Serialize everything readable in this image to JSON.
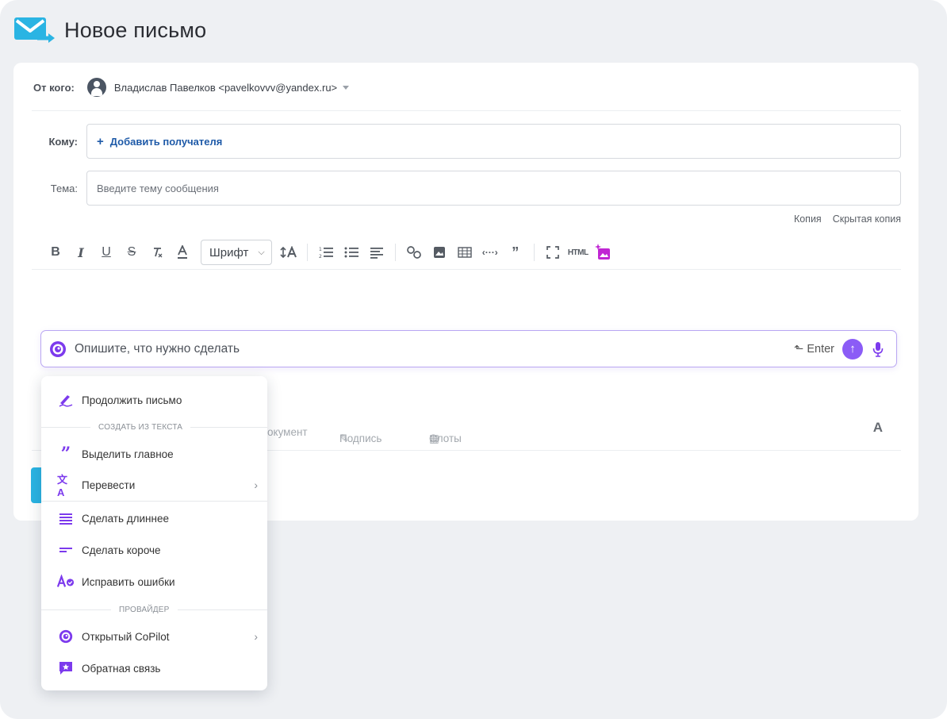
{
  "header": {
    "title": "Новое письмо"
  },
  "from": {
    "label": "От кого:",
    "value": "Владислав Павелков <pavelkovvv@yandex.ru>"
  },
  "to": {
    "label": "Кому:",
    "add_label": "Добавить получателя"
  },
  "subject": {
    "label": "Тема:",
    "placeholder": "Введите тему сообщения"
  },
  "cc": {
    "copy": "Копия",
    "bcc": "Скрытая копия"
  },
  "toolbar": {
    "bold": "B",
    "italic": "I",
    "underline": "U",
    "strike": "S",
    "font_label": "Шрифт",
    "html": "HTML"
  },
  "ai": {
    "placeholder": "Опишите, что нужно сделать",
    "enter_hint": "Enter"
  },
  "bottom": {
    "document": "окумент",
    "signature": "Подпись",
    "slots": "Слоты",
    "font_a": "A"
  },
  "menu": {
    "continue": "Продолжить письмо",
    "section_create": "СОЗДАТЬ ИЗ ТЕКСТА",
    "highlight": "Выделить главное",
    "translate": "Перевести",
    "longer": "Сделать длиннее",
    "shorter": "Сделать короче",
    "fix": "Исправить ошибки",
    "section_provider": "ПРОВАЙДЕР",
    "copilot": "Открытый CoPilot",
    "feedback": "Обратная связь"
  },
  "colors": {
    "accent": "#8b5cf6",
    "link": "#1e5aa8",
    "brand": "#2ab4e3"
  }
}
